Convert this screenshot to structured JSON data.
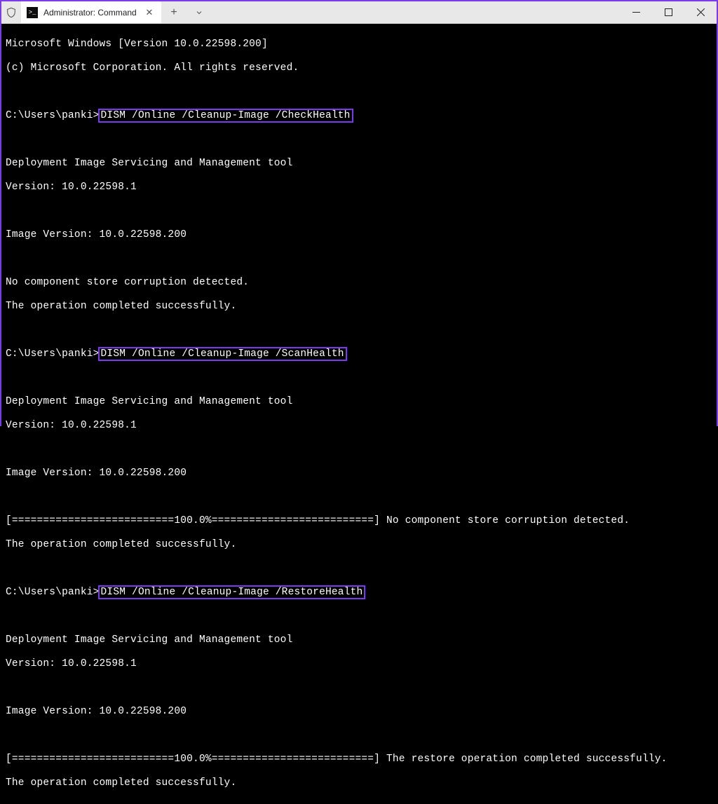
{
  "window": {
    "title": "Administrator: Command Prompt"
  },
  "terminal": {
    "header": {
      "line1": "Microsoft Windows [Version 10.0.22598.200]",
      "line2": "(c) Microsoft Corporation. All rights reserved."
    },
    "prompt_path": "C:\\Users\\panki>",
    "blocks": [
      {
        "command": "DISM /Online /Cleanup-Image /CheckHealth",
        "tool": "Deployment Image Servicing and Management tool",
        "version": "Version: 10.0.22598.1",
        "image_version": "Image Version: 10.0.22598.200",
        "result1": "No component store corruption detected.",
        "result2": "The operation completed successfully."
      },
      {
        "command": "DISM /Online /Cleanup-Image /ScanHealth",
        "tool": "Deployment Image Servicing and Management tool",
        "version": "Version: 10.0.22598.1",
        "image_version": "Image Version: 10.0.22598.200",
        "progress": "[==========================100.0%==========================] No component store corruption detected.",
        "result2": "The operation completed successfully."
      },
      {
        "command": "DISM /Online /Cleanup-Image /RestoreHealth",
        "tool": "Deployment Image Servicing and Management tool",
        "version": "Version: 10.0.22598.1",
        "image_version": "Image Version: 10.0.22598.200",
        "progress": "[==========================100.0%==========================] The restore operation completed successfully.",
        "result2": "The operation completed successfully."
      }
    ]
  }
}
